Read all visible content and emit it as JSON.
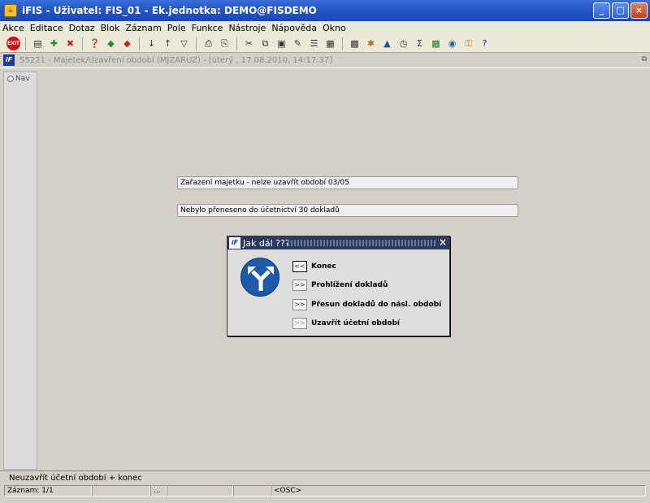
{
  "window": {
    "title": "iFIS - Uživatel: FIS_01 - Ek.jednotka: DEMO@FISDEMO",
    "app_icon": "java-cup-icon",
    "controls": [
      "_",
      "□",
      "×"
    ]
  },
  "menu": [
    "Akce",
    "Editace",
    "Dotaz",
    "Blok",
    "Záznam",
    "Pole",
    "Funkce",
    "Nástroje",
    "Nápověda",
    "Okno"
  ],
  "toolbar": {
    "exit_label": "EXIT",
    "groups": [
      [
        "save-icon",
        "new-record-icon",
        "delete-record-icon"
      ],
      [
        "enter-query-icon",
        "execute-query-icon",
        "cancel-query-icon"
      ],
      [
        "sort-asc-icon",
        "sort-desc-icon",
        "filter-icon"
      ],
      [
        "print-icon",
        "print-setup-icon"
      ],
      [
        "cut-icon",
        "copy-icon",
        "paste-icon",
        "edit-icon",
        "list-icon",
        "grid-icon"
      ],
      [
        "calculator-icon",
        "tools-icon",
        "chart-icon",
        "clock-icon",
        "sum-icon",
        "excel-icon",
        "web-icon",
        "key-icon",
        "help-icon"
      ]
    ]
  },
  "form": {
    "title": "55221 - Majetek/Uzavření období (MJZARUZ) - [úterý , 17.08.2010, 14:17:37]",
    "icon_text": "iF"
  },
  "nav": {
    "label": "Nav"
  },
  "messages": [
    "Zařazení majetku - nelze uzavřít období 03/05",
    "Nebylo přeneseno do účetnictví 30 dokladů"
  ],
  "dialog": {
    "title": "Jak dál ???",
    "icon_text": "iF",
    "close": "×",
    "options": [
      {
        "button": "<<",
        "label": "Konec",
        "selected": true,
        "dim": false
      },
      {
        "button": ">>",
        "label": "Prohlížení dokladů",
        "selected": false,
        "dim": false
      },
      {
        "button": ">>",
        "label": "Přesun dokladů do násl. období",
        "selected": false,
        "dim": false
      },
      {
        "button": ">>",
        "label": "Uzavřít účetní období",
        "selected": false,
        "dim": true
      }
    ]
  },
  "hint": "Neuzavřít účetní období + konec",
  "status": {
    "record": "Záznam: 1/1",
    "cell2": "",
    "cell3": "...",
    "cell4": "",
    "cell5": "",
    "mode": "<OSC>"
  },
  "colors": {
    "titlebar": "#2658c8",
    "dialog_title": "#2a3a60",
    "exit_red": "#d01010",
    "sign_blue": "#1e5aa8"
  }
}
